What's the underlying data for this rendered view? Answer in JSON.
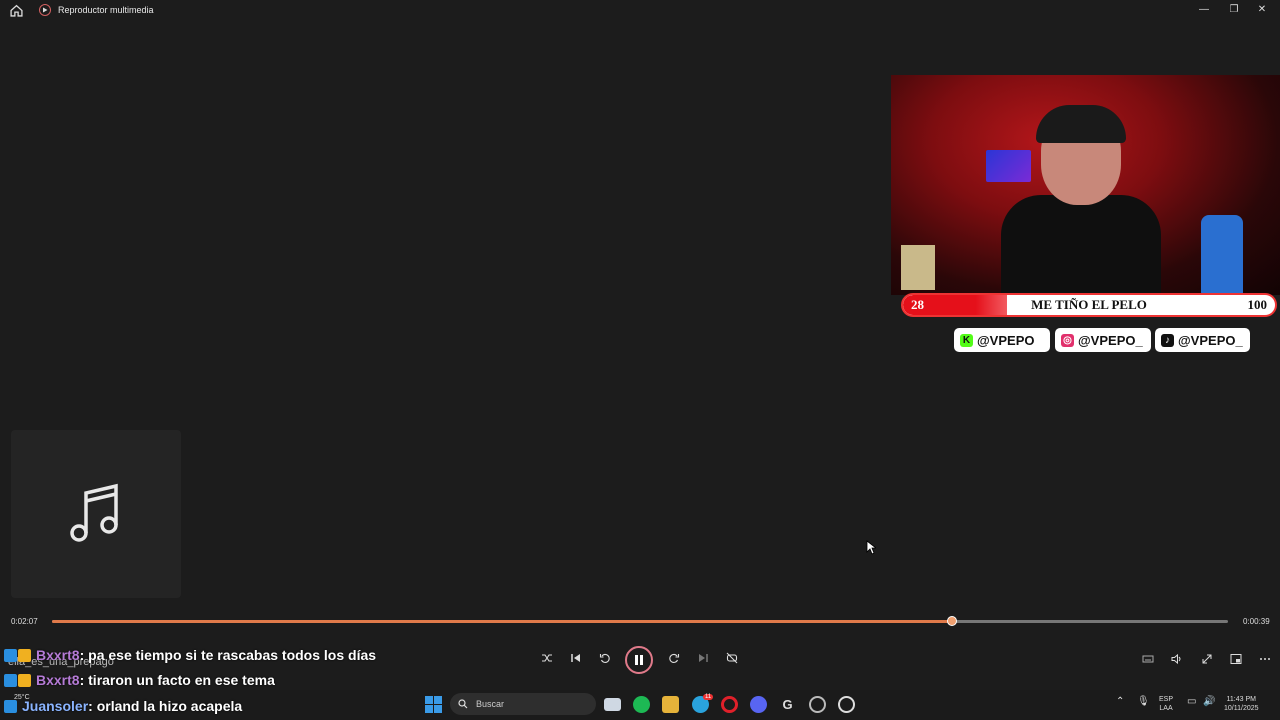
{
  "window": {
    "title": "Reproductor multimedia",
    "controls": {
      "minimize": "—",
      "restore": "❐",
      "close": "✕"
    }
  },
  "stream_overlay": {
    "goal_bar": {
      "current": "28",
      "label": "ME TIÑO EL PELO",
      "max": "100",
      "progress_fraction": 0.28
    },
    "socials": [
      {
        "platform": "kick",
        "handle": "@VPEPO",
        "color": "#53fc18"
      },
      {
        "platform": "instagram",
        "handle": "@VPEPO_",
        "color": "#e1306c"
      },
      {
        "platform": "tiktok",
        "handle": "@VPEPO_",
        "color": "#111111"
      }
    ]
  },
  "player": {
    "elapsed": "0:02:07",
    "remaining": "0:00:39",
    "progress_fraction": 0.765,
    "accent": "#e07a4a"
  },
  "chat": [
    {
      "user": "Bxxrt8",
      "message": ": pa ese tiempo si te rascabas todos los días"
    },
    {
      "user": "Bxxrt8",
      "message": ": tiraron un facto en ese tema"
    },
    {
      "user": "Juansoler",
      "message": ": orland la hizo acapela"
    }
  ],
  "chat_ghost_text": "ella_es_una_prepago",
  "taskbar": {
    "search_placeholder": "Buscar",
    "weather": "25°C",
    "language": "ESP",
    "layout": "LAA",
    "time": "11:43 PM",
    "date": "10/11/2025",
    "telegram_badge": "11"
  }
}
